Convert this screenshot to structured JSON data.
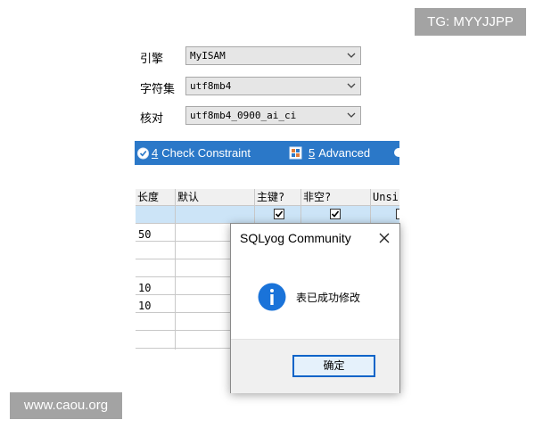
{
  "watermarks": {
    "top_right": "TG: MYYJJPP",
    "bottom_left": "www.caou.org"
  },
  "form": {
    "engine": {
      "label": "引擎",
      "value": "MyISAM"
    },
    "charset": {
      "label": "字符集",
      "value": "utf8mb4"
    },
    "collation": {
      "label": "核对",
      "value": "utf8mb4_0900_ai_ci"
    }
  },
  "tabs": [
    {
      "num": "4",
      "label": "Check Constraint",
      "icon": "check-constraint-icon"
    },
    {
      "num": "5",
      "label": "Advanced",
      "icon": "advanced-icon"
    }
  ],
  "grid": {
    "headers": [
      "长度",
      "默认",
      "主键?",
      "非空?",
      "Unsi"
    ],
    "rows": [
      {
        "length": "",
        "selected": true,
        "pk": true,
        "nn": true
      },
      {
        "length": "50"
      },
      {
        "length": ""
      },
      {
        "length": ""
      },
      {
        "length": "10"
      },
      {
        "length": "10"
      },
      {
        "length": ""
      },
      {
        "length": ""
      },
      {
        "length": ""
      }
    ]
  },
  "dialog": {
    "title": "SQLyog Community",
    "message": "表已成功修改",
    "ok_label": "确定"
  },
  "colors": {
    "tab_bar": "#2b78c8",
    "selected_row": "#cce4f7",
    "ok_border": "#0a64c8",
    "info_icon": "#1a73d9"
  }
}
